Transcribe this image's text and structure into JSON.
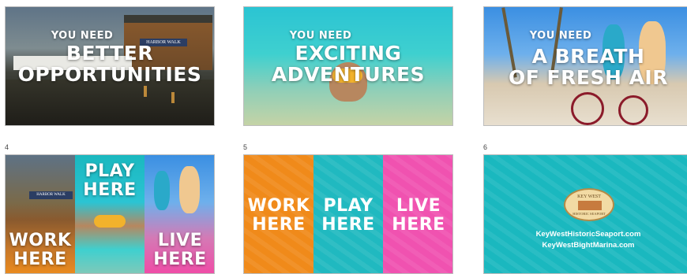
{
  "slide_numbers": [
    "4",
    "5",
    "6"
  ],
  "slide1": {
    "line1": "YOU NEED",
    "line2": "BETTER",
    "line3": "OPPORTUNITIES",
    "sign": "HARBOR WALK"
  },
  "slide2": {
    "line1": "YOU NEED",
    "line2": "EXCITING",
    "line3": "ADVENTURES"
  },
  "slide3": {
    "line1": "YOU NEED",
    "line2": "A BREATH",
    "line3": "OF FRESH AIR"
  },
  "slide4": {
    "work": [
      "WORK",
      "HERE"
    ],
    "play": [
      "PLAY",
      "HERE"
    ],
    "live": [
      "LIVE",
      "HERE"
    ],
    "sign": "HARBOR WALK",
    "colors": {
      "work": "#e98a1f",
      "play": "#1ab8bf",
      "live": "#ef4da7"
    }
  },
  "slide5": {
    "work": [
      "WORK",
      "HERE"
    ],
    "play": [
      "PLAY",
      "HERE"
    ],
    "live": [
      "LIVE",
      "HERE"
    ],
    "colors": {
      "work": "#f08a1a",
      "play": "#20b9c0",
      "live": "#f052b0"
    }
  },
  "slide6": {
    "logo_top": "KEY WEST",
    "logo_bottom": "HISTORIC SEAPORT",
    "url1": "KeyWestHistoricSeaport.com",
    "url2": "KeyWestBightMarina.com",
    "background": "#1ab8bf"
  }
}
